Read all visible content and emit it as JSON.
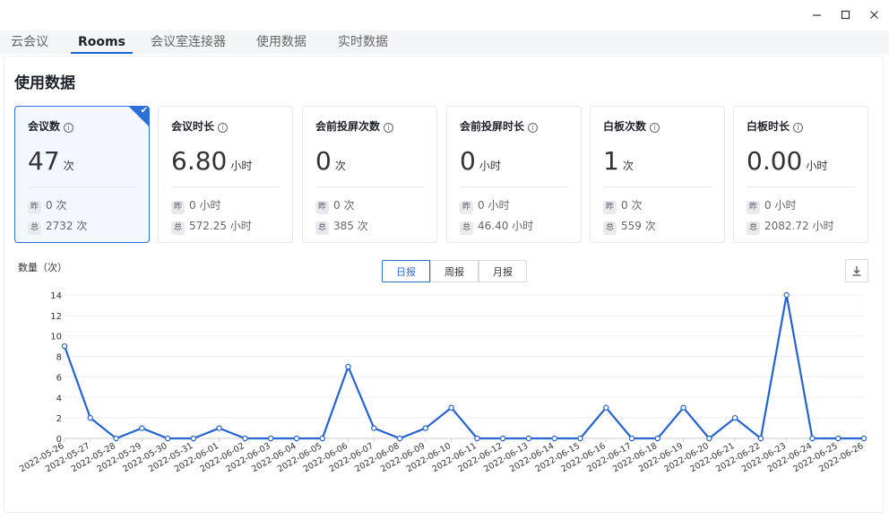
{
  "window": {
    "minimize_icon": "minimize-icon",
    "maximize_icon": "maximize-icon",
    "close_icon": "close-icon"
  },
  "tabs": [
    {
      "label": "云会议",
      "active": false
    },
    {
      "label": "Rooms",
      "active": true
    },
    {
      "label": "会议室连接器",
      "active": false
    },
    {
      "label": "使用数据",
      "active": false
    },
    {
      "label": "实时数据",
      "active": false
    }
  ],
  "page_title": "使用数据",
  "info_glyph": "i",
  "cards": [
    {
      "title": "会议数",
      "value": "47",
      "unit": "次",
      "yesterday_tag": "昨",
      "yesterday": "0 次",
      "total_tag": "总",
      "total": "2732 次",
      "selected": true
    },
    {
      "title": "会议时长",
      "value": "6.80",
      "unit": "小时",
      "yesterday_tag": "昨",
      "yesterday": "0 小时",
      "total_tag": "总",
      "total": "572.25 小时",
      "selected": false
    },
    {
      "title": "会前投屏次数",
      "value": "0",
      "unit": "次",
      "yesterday_tag": "昨",
      "yesterday": "0 次",
      "total_tag": "总",
      "total": "385 次",
      "selected": false
    },
    {
      "title": "会前投屏时长",
      "value": "0",
      "unit": "小时",
      "yesterday_tag": "昨",
      "yesterday": "0 小时",
      "total_tag": "总",
      "total": "46.40 小时",
      "selected": false
    },
    {
      "title": "白板次数",
      "value": "1",
      "unit": "次",
      "yesterday_tag": "昨",
      "yesterday": "0 次",
      "total_tag": "总",
      "total": "559 次",
      "selected": false
    },
    {
      "title": "白板时长",
      "value": "0.00",
      "unit": "小时",
      "yesterday_tag": "昨",
      "yesterday": "0 小时",
      "total_tag": "总",
      "total": "2082.72 小时",
      "selected": false
    }
  ],
  "period_toggle": [
    "日报",
    "周报",
    "月报"
  ],
  "period_active": 0,
  "colors": {
    "accent": "#2b6fd9",
    "line": "#2563d4"
  },
  "chart_data": {
    "type": "line",
    "ylabel": "数量（次）",
    "ylim": [
      0,
      14
    ],
    "yticks": [
      0,
      2,
      4,
      6,
      8,
      10,
      12,
      14
    ],
    "grid": true,
    "x": [
      "2022-05-26",
      "2022-05-27",
      "2022-05-28",
      "2022-05-29",
      "2022-05-30",
      "2022-05-31",
      "2022-06-01",
      "2022-06-02",
      "2022-06-03",
      "2022-06-04",
      "2022-06-05",
      "2022-06-06",
      "2022-06-07",
      "2022-06-08",
      "2022-06-09",
      "2022-06-10",
      "2022-06-11",
      "2022-06-12",
      "2022-06-13",
      "2022-06-14",
      "2022-06-15",
      "2022-06-16",
      "2022-06-17",
      "2022-06-18",
      "2022-06-19",
      "2022-06-20",
      "2022-06-21",
      "2022-06-22",
      "2022-06-23",
      "2022-06-24",
      "2022-06-25",
      "2022-06-26"
    ],
    "values": [
      9,
      2,
      0,
      1,
      0,
      0,
      1,
      0,
      0,
      0,
      0,
      7,
      1,
      0,
      1,
      3,
      0,
      0,
      0,
      0,
      0,
      3,
      0,
      0,
      3,
      0,
      2,
      0,
      14,
      0,
      0,
      0
    ]
  }
}
